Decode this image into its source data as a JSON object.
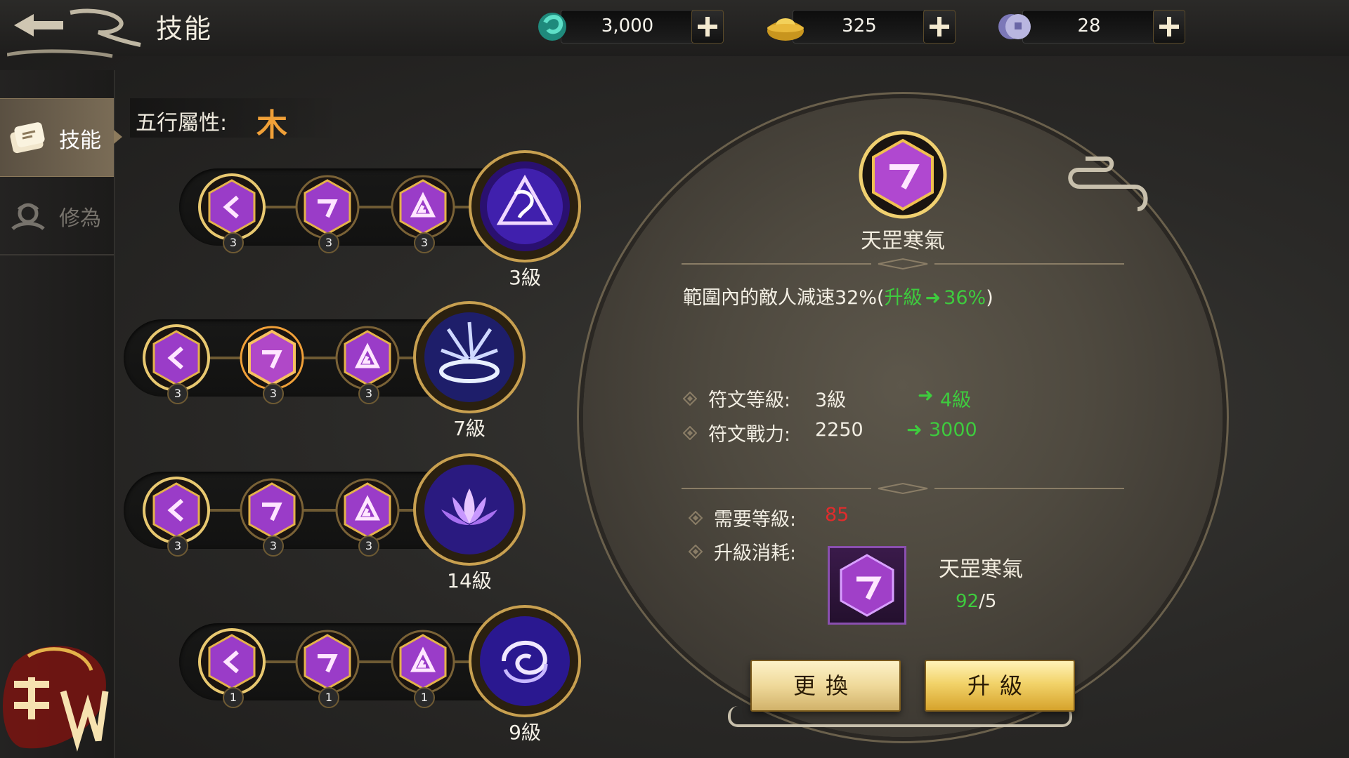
{
  "header": {
    "title": "技能",
    "currencies": [
      {
        "name": "jade",
        "icon": "jade-icon",
        "amount": "3,000"
      },
      {
        "name": "gold",
        "icon": "gold-ingot-icon",
        "amount": "325"
      },
      {
        "name": "silver",
        "icon": "silver-coin-icon",
        "amount": "28"
      }
    ]
  },
  "sidebar": {
    "items": [
      {
        "label": "技能",
        "icon": "scroll-icon",
        "active": true
      },
      {
        "label": "修為",
        "icon": "cultivation-icon",
        "active": false
      }
    ],
    "logo_text": "遠征M"
  },
  "element": {
    "label": "五行屬性:",
    "value": "木"
  },
  "skill_tree": {
    "rows": [
      {
        "runes": [
          {
            "count": "3"
          },
          {
            "count": "3"
          },
          {
            "count": "3"
          }
        ],
        "level": "3級",
        "skill_icon": "triangle-sigil-icon"
      },
      {
        "runes": [
          {
            "count": "3"
          },
          {
            "count": "3"
          },
          {
            "count": "3"
          }
        ],
        "level": "7級",
        "skill_icon": "burst-icon"
      },
      {
        "runes": [
          {
            "count": "3"
          },
          {
            "count": "3"
          },
          {
            "count": "3"
          }
        ],
        "level": "14級",
        "skill_icon": "lotus-icon"
      },
      {
        "runes": [
          {
            "count": "1"
          },
          {
            "count": "1"
          },
          {
            "count": "1"
          }
        ],
        "level": "9級",
        "skill_icon": "vortex-icon"
      }
    ]
  },
  "detail": {
    "name": "天罡寒氣",
    "desc_prefix": "範圍內的敵人減速32%(",
    "desc_upgrade": "升級",
    "desc_next": "36%",
    "desc_suffix": ")",
    "rune_level_label": "符文等級:",
    "rune_level_value": "3級",
    "rune_level_next": "4級",
    "rune_power_label": "符文戰力:",
    "rune_power_value": "2250",
    "rune_power_next": "3000",
    "required_level_label": "需要等級:",
    "required_level_value": "85",
    "cost_label": "升級消耗:",
    "cost_item_name": "天罡寒氣",
    "cost_have": "92",
    "cost_sep": "/",
    "cost_need": "5"
  },
  "buttons": {
    "replace": "更換",
    "upgrade": "升級"
  },
  "colors": {
    "accent_gold": "#f0a038",
    "upgrade_green": "#3ecb3e",
    "warning_red": "#e02c2c",
    "rune_purple": "#9a3cc8"
  }
}
